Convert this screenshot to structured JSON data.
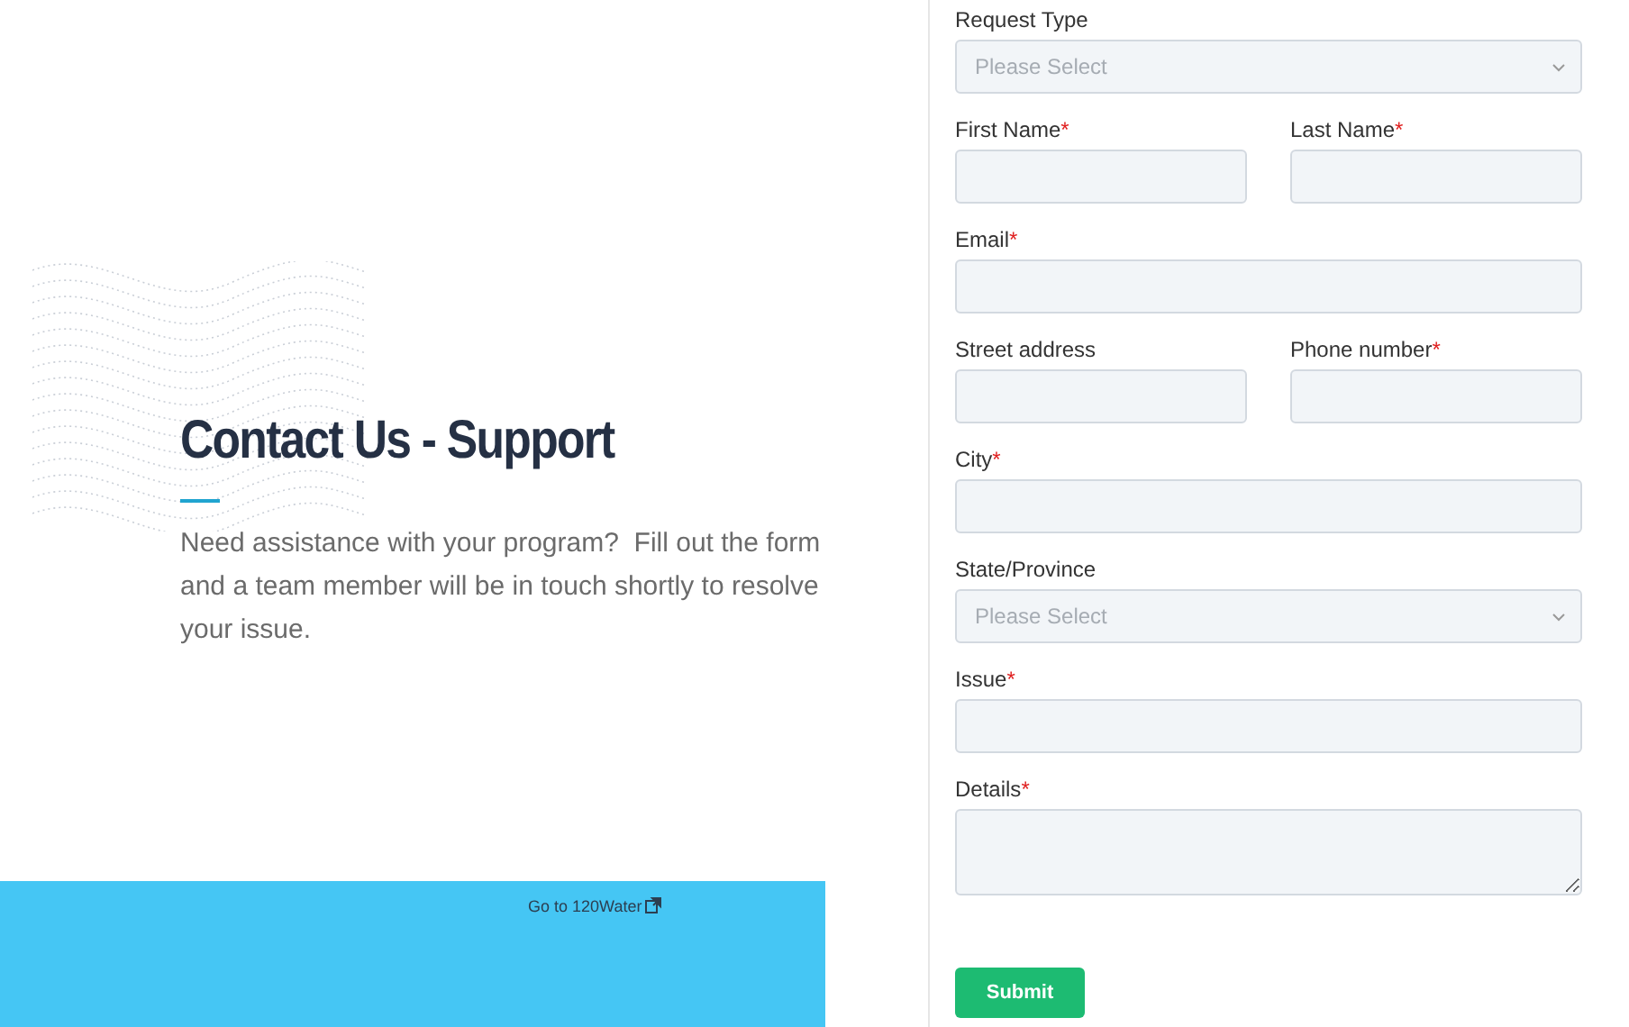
{
  "intro": {
    "title": "Contact Us - Support",
    "text": "Need assistance with your program?  Fill out the form and a team member will be in touch shortly to resolve your issue."
  },
  "footer": {
    "link": "Go to 120Water"
  },
  "form": {
    "rows": [
      [
        {
          "label": "Request Type",
          "kind": "select",
          "placeholder": "Please Select"
        }
      ],
      [
        {
          "label": "First Name",
          "mark": "*",
          "kind": "text"
        },
        {
          "label": "Last Name",
          "mark": "*",
          "kind": "text"
        }
      ],
      [
        {
          "label": "Email",
          "mark": "*",
          "kind": "text"
        }
      ],
      [
        {
          "label": "Street address",
          "kind": "text"
        },
        {
          "label": "Phone number",
          "mark": "*",
          "kind": "text"
        }
      ],
      [
        {
          "label": "City",
          "mark": "*",
          "kind": "text"
        }
      ],
      [
        {
          "label": "State/Province",
          "kind": "select",
          "placeholder": "Please Select"
        }
      ],
      [
        {
          "label": "Issue",
          "mark": "*",
          "kind": "text"
        }
      ],
      [
        {
          "label": "Details",
          "mark": "*",
          "kind": "textarea"
        }
      ]
    ],
    "submit": "Submit"
  }
}
